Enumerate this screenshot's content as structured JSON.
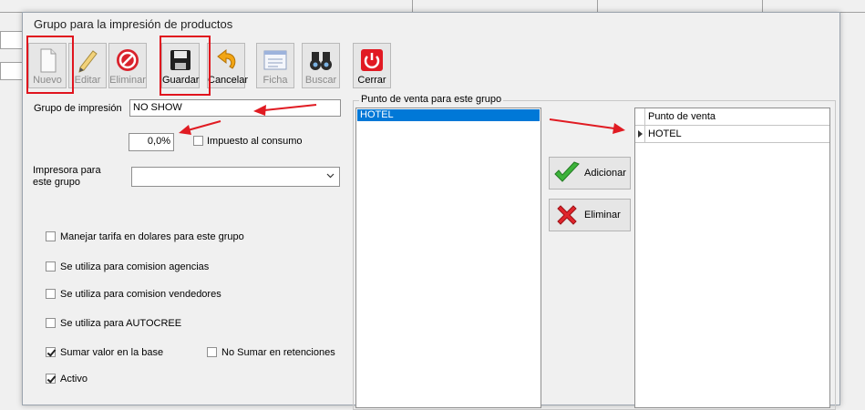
{
  "dialog": {
    "title": "Grupo para la impresión de productos"
  },
  "toolbar": {
    "nuevo": "Nuevo",
    "editar": "Editar",
    "eliminar": "Eliminar",
    "guardar": "Guardar",
    "cancelar": "Cancelar",
    "ficha": "Ficha",
    "buscar": "Buscar",
    "cerrar": "Cerrar"
  },
  "form": {
    "grupo_label": "Grupo de impresión",
    "grupo_value": "NO SHOW",
    "impuesto_value": "0,0%",
    "impuesto_label": "Impuesto al consumo",
    "impresora_label": "Impresora para este grupo",
    "impresora_value": "",
    "checks": {
      "dolares": "Manejar tarifa en dolares para este grupo",
      "agencias": "Se utiliza para comision agencias",
      "vendedores": "Se utiliza para comision vendedores",
      "autocree": "Se utiliza para AUTOCREE",
      "sumar": "Sumar valor en la base",
      "no_sumar": "No Sumar en retenciones",
      "activo": "Activo"
    }
  },
  "pos": {
    "group_label": "Punto de venta para este grupo",
    "list_items": [
      "HOTEL"
    ],
    "add_button": "Adicionar",
    "remove_button": "Eliminar",
    "grid_header": "Punto de venta",
    "grid_rows": [
      "HOTEL"
    ]
  }
}
